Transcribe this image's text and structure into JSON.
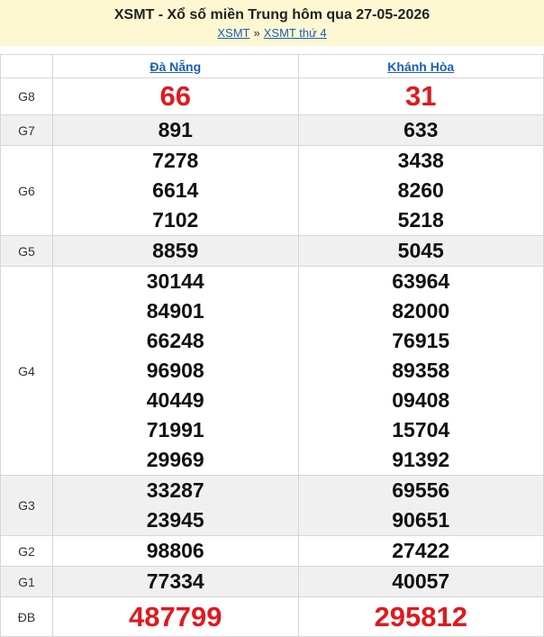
{
  "header": {
    "title": "XSMT - Xổ số miền Trung hôm qua 27-05-2026",
    "crumbs": [
      "XSMT",
      "XSMT thứ 4"
    ],
    "separator": "»"
  },
  "provinces": [
    "Đà Nẵng",
    "Khánh Hòa"
  ],
  "prizes": [
    {
      "label": "G8",
      "values": [
        [
          "66"
        ],
        [
          "31"
        ]
      ]
    },
    {
      "label": "G7",
      "values": [
        [
          "891"
        ],
        [
          "633"
        ]
      ]
    },
    {
      "label": "G6",
      "values": [
        [
          "7278",
          "6614",
          "7102"
        ],
        [
          "3438",
          "8260",
          "5218"
        ]
      ]
    },
    {
      "label": "G5",
      "values": [
        [
          "8859"
        ],
        [
          "5045"
        ]
      ]
    },
    {
      "label": "G4",
      "values": [
        [
          "30144",
          "84901",
          "66248",
          "96908",
          "40449",
          "71991",
          "29969"
        ],
        [
          "63964",
          "82000",
          "76915",
          "89358",
          "09408",
          "15704",
          "91392"
        ]
      ]
    },
    {
      "label": "G3",
      "values": [
        [
          "33287",
          "23945"
        ],
        [
          "69556",
          "90651"
        ]
      ]
    },
    {
      "label": "G2",
      "values": [
        [
          "98806"
        ],
        [
          "27422"
        ]
      ]
    },
    {
      "label": "G1",
      "values": [
        [
          "77334"
        ],
        [
          "40057"
        ]
      ]
    },
    {
      "label": "ĐB",
      "values": [
        [
          "487799"
        ],
        [
          "295812"
        ]
      ]
    }
  ],
  "colors": {
    "highlight": "#e0191f",
    "header_bg": "#fdf8d2",
    "link": "#1a5fb4"
  }
}
